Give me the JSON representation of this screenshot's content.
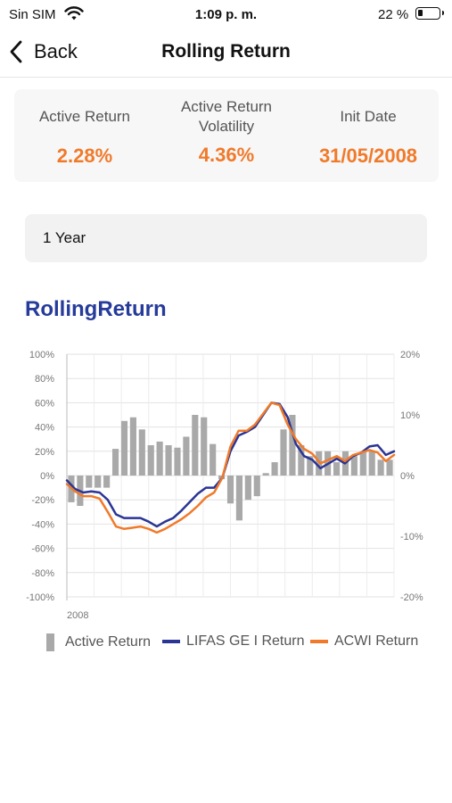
{
  "status_bar": {
    "carrier": "Sin SIM",
    "time": "1:09 p. m.",
    "battery_percent": "22 %",
    "battery_level": 0.22
  },
  "nav": {
    "back_label": "Back",
    "title": "Rolling Return"
  },
  "summary": {
    "active_return_label": "Active Return",
    "active_return_value": "2.28%",
    "volatility_label_line1": "Active Return",
    "volatility_label_line2": "Volatility",
    "volatility_value": "4.36%",
    "init_date_label": "Init Date",
    "init_date_value": "31/05/2008",
    "value_color": "#f07a2a"
  },
  "period": {
    "selected": "1 Year"
  },
  "chart_title": "RollingReturn",
  "chart_data": {
    "type": "bar",
    "x_tick_labels": [
      "2008"
    ],
    "y_left_ticks": [
      "100%",
      "80%",
      "60%",
      "40%",
      "20%",
      "0%",
      "-20%",
      "-40%",
      "-60%",
      "-80%",
      "-100%"
    ],
    "y_right_ticks": [
      "20%",
      "10%",
      "0%",
      "-10%",
      "-20%"
    ],
    "y_left_range": [
      -100,
      100
    ],
    "y_right_range": [
      -20,
      20
    ],
    "grid": true,
    "legend_position": "bottom",
    "series": [
      {
        "name": "Active Return",
        "type": "bar",
        "axis": "right",
        "color": "#a9a9a9",
        "values": [
          -4.4,
          -5,
          -2,
          -2,
          -2,
          4.4,
          9,
          9.6,
          7.6,
          5,
          5.6,
          5,
          4.6,
          6.4,
          10,
          9.6,
          5.2,
          -0.6,
          -4.6,
          -7.4,
          -4,
          -3.4,
          0.4,
          2.2,
          7.6,
          10,
          5,
          3.2,
          4,
          4,
          2.2,
          4,
          3.2,
          4,
          4,
          2.6,
          2.6
        ]
      },
      {
        "name": "LIFAS GE I Return",
        "type": "line",
        "axis": "left",
        "color": "#2a3594",
        "values": [
          -4,
          -11,
          -14,
          -13,
          -14,
          -20,
          -32,
          -35,
          -35,
          -35,
          -38,
          -42,
          -38,
          -35,
          -29,
          -22,
          -15,
          -10,
          -10,
          -2,
          20,
          33,
          36,
          40,
          50,
          60,
          59,
          48,
          26,
          16,
          13,
          6,
          10,
          14,
          10,
          16,
          19,
          24,
          25,
          17,
          20
        ]
      },
      {
        "name": "ACWI Return",
        "type": "line",
        "axis": "left",
        "color": "#f07a2a",
        "values": [
          -7,
          -13,
          -17,
          -17,
          -19,
          -30,
          -42,
          -44,
          -43,
          -42,
          -44,
          -47,
          -44,
          -40,
          -36,
          -31,
          -25,
          -18,
          -14,
          -2,
          24,
          37,
          37,
          42,
          51,
          60,
          58,
          42,
          30,
          22,
          18,
          10,
          13,
          16,
          12,
          17,
          19,
          21,
          19,
          12,
          17
        ]
      }
    ]
  }
}
